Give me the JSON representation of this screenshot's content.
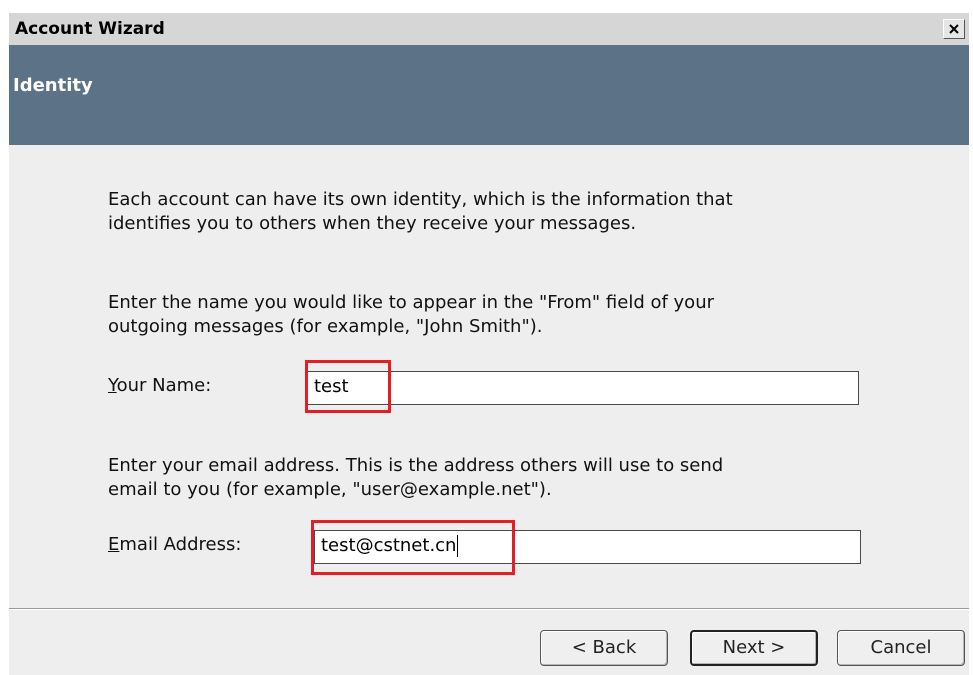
{
  "window": {
    "title": "Account Wizard",
    "close_icon": "close-icon"
  },
  "header": {
    "title": "Identity"
  },
  "content": {
    "intro_lines": [
      "Each account can have its own identity, which is the information that",
      "identifies you to others when they receive your messages."
    ],
    "name_instructions_lines": [
      "Enter the name you would like to appear in the \"From\" field of your",
      "outgoing messages (for example, \"John Smith\")."
    ],
    "name_field": {
      "label_mnemonic": "Y",
      "label_rest": "our Name:",
      "value": "test"
    },
    "email_instructions_lines": [
      "Enter your email address. This is the address others will use to send",
      "email to you (for example, \"user@example.net\")."
    ],
    "email_field": {
      "label_mnemonic": "E",
      "label_rest": "mail Address:",
      "value": "test@cstnet.cn"
    }
  },
  "buttons": {
    "back": "< Back",
    "next": "Next >",
    "cancel": "Cancel"
  },
  "colors": {
    "banner": "#5b7287",
    "highlight": "#e31e24",
    "dialog_background": "#eeeeee"
  }
}
